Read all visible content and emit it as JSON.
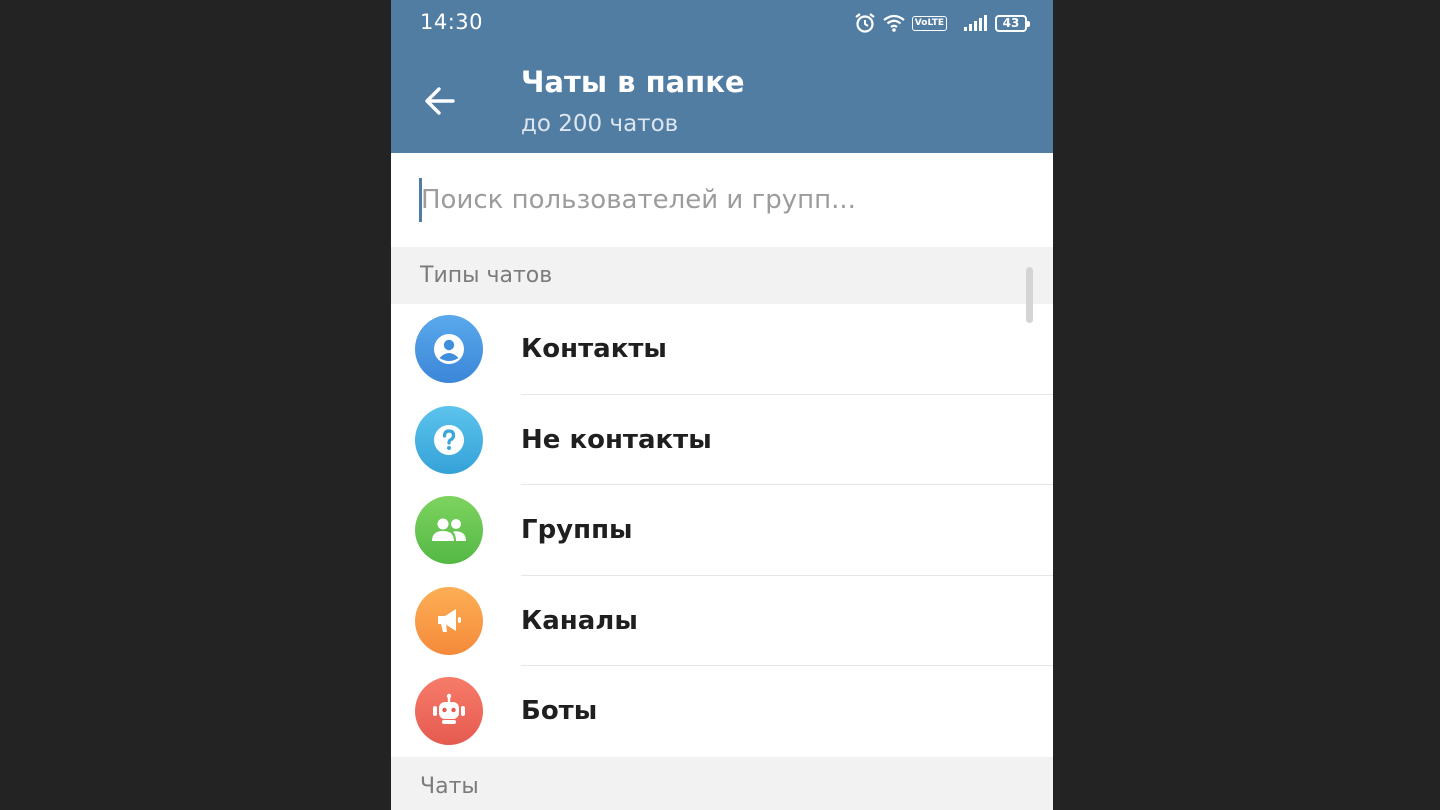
{
  "status_bar": {
    "time": "14:30",
    "volte_label": "VoLTE",
    "battery_level": "43"
  },
  "app_bar": {
    "title": "Чаты в папке",
    "subtitle": "до 200 чатов"
  },
  "search": {
    "placeholder": "Поиск пользователей и групп..."
  },
  "sections": {
    "chat_types_header": "Типы чатов",
    "chats_header": "Чаты"
  },
  "chat_types": [
    {
      "label": "Контакты",
      "icon": "contact-icon",
      "color_top": "#5aa9ec",
      "color_bottom": "#3b86d8"
    },
    {
      "label": "Не контакты",
      "icon": "question-icon",
      "color_top": "#5cc3ec",
      "color_bottom": "#35a2d8"
    },
    {
      "label": "Группы",
      "icon": "group-icon",
      "color_top": "#7ed35f",
      "color_bottom": "#54b845"
    },
    {
      "label": "Каналы",
      "icon": "megaphone-icon",
      "color_top": "#fdaf56",
      "color_bottom": "#f48a3a"
    },
    {
      "label": "Боты",
      "icon": "bot-icon",
      "color_top": "#f77c6a",
      "color_bottom": "#e55a4f"
    }
  ],
  "colors": {
    "accent": "#527da3",
    "background": "#232323"
  }
}
